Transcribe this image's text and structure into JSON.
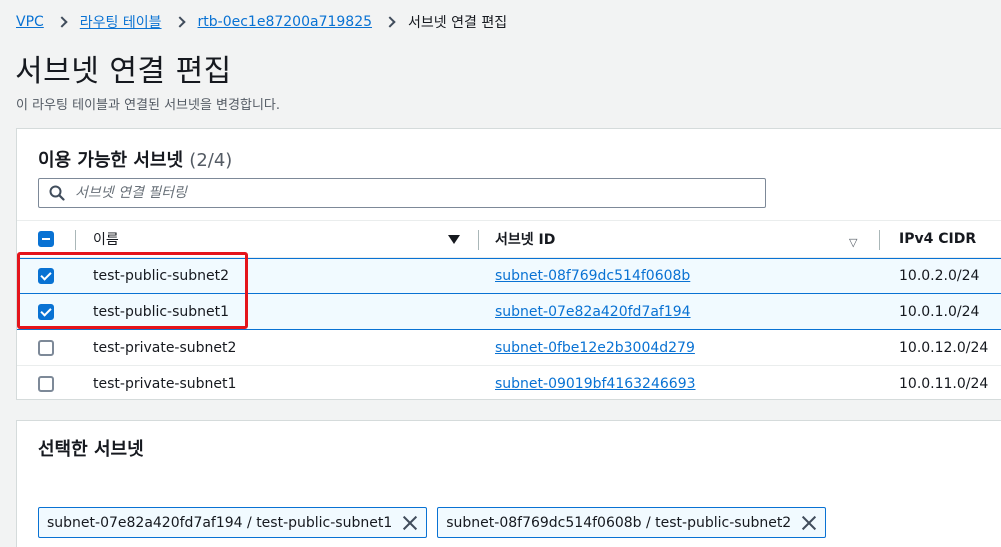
{
  "breadcrumb": {
    "items": [
      "VPC",
      "라우팅 테이블",
      "rtb-0ec1e87200a719825"
    ],
    "current": "서브넷 연결 편집"
  },
  "page": {
    "title": "서브넷 연결 편집",
    "description": "이 라우팅 테이블과 연결된 서브넷을 변경합니다."
  },
  "available": {
    "heading": "이용 가능한 서브넷",
    "count": "(2/4)",
    "filter_placeholder": "서브넷 연결 필터링",
    "columns": {
      "name": "이름",
      "subnet_id": "서브넷 ID",
      "cidr": "IPv4 CIDR"
    },
    "rows": [
      {
        "name": "test-public-subnet2",
        "subnet_id": "subnet-08f769dc514f0608b",
        "cidr": "10.0.2.0/24",
        "checked": true
      },
      {
        "name": "test-public-subnet1",
        "subnet_id": "subnet-07e82a420fd7af194",
        "cidr": "10.0.1.0/24",
        "checked": true
      },
      {
        "name": "test-private-subnet2",
        "subnet_id": "subnet-0fbe12e2b3004d279",
        "cidr": "10.0.12.0/24",
        "checked": false
      },
      {
        "name": "test-private-subnet1",
        "subnet_id": "subnet-09019bf4163246693",
        "cidr": "10.0.11.0/24",
        "checked": false
      }
    ]
  },
  "selected": {
    "heading": "선택한 서브넷",
    "tokens": [
      "subnet-07e82a420fd7af194 / test-public-subnet1",
      "subnet-08f769dc514f0608b / test-public-subnet2"
    ]
  },
  "colors": {
    "accent": "#0972d3",
    "highlight": "#e4141b",
    "selected_row": "#f1faff"
  },
  "icons": {
    "search": "search-icon",
    "remove": "close-icon",
    "sort": "sort-icon"
  }
}
